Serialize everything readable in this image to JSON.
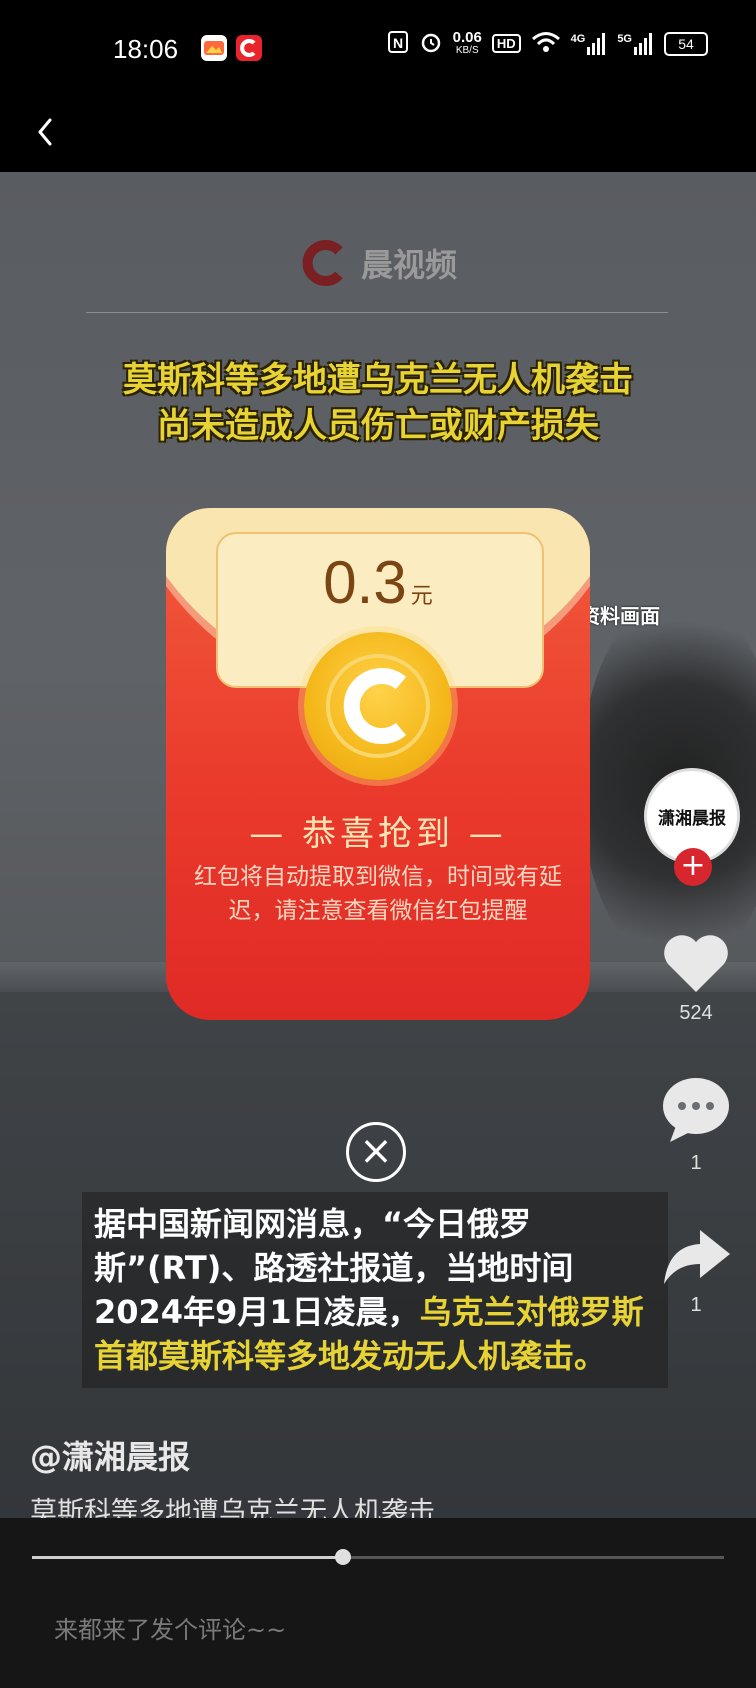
{
  "status_bar": {
    "time": "18:06",
    "net_speed_value": "0.06",
    "net_speed_unit": "KB/S",
    "hd_label": "HD",
    "signal_4g": "4G",
    "signal_5g": "5G",
    "battery": "54"
  },
  "video": {
    "watermark": "晨视频",
    "headline_line1": "莫斯科等多地遭乌克兰无人机袭击",
    "headline_line2": "尚未造成人员伤亡或财产损失",
    "resource_label": "资料画面",
    "subtitle_part1": "据中国新闻网消息，“今日俄罗斯”(RT)、路透社报道，当地时间2024年9月1日凌晨，",
    "subtitle_part2": "乌克兰对俄罗斯首都莫斯科等多地发动无人机袭击。"
  },
  "side_actions": {
    "avatar_text": "潇湘晨报",
    "likes": "524",
    "comments": "1",
    "shares": "1"
  },
  "post": {
    "author": "@潇湘晨报",
    "description": "莫斯科等多地遭乌克兰无人机袭击",
    "progress": 0.45,
    "comment_placeholder": "来都来了发个评论~~"
  },
  "red_packet": {
    "amount": "0.3",
    "unit": "元",
    "congrats": "— 恭喜抢到 —",
    "note": "红包将自动提取到微信，时间或有延迟，请注意查看微信红包提醒"
  },
  "colors": {
    "packet_red": "#ea3a2c",
    "headline_yellow": "#e8d335",
    "brand_red": "#d8262e"
  }
}
